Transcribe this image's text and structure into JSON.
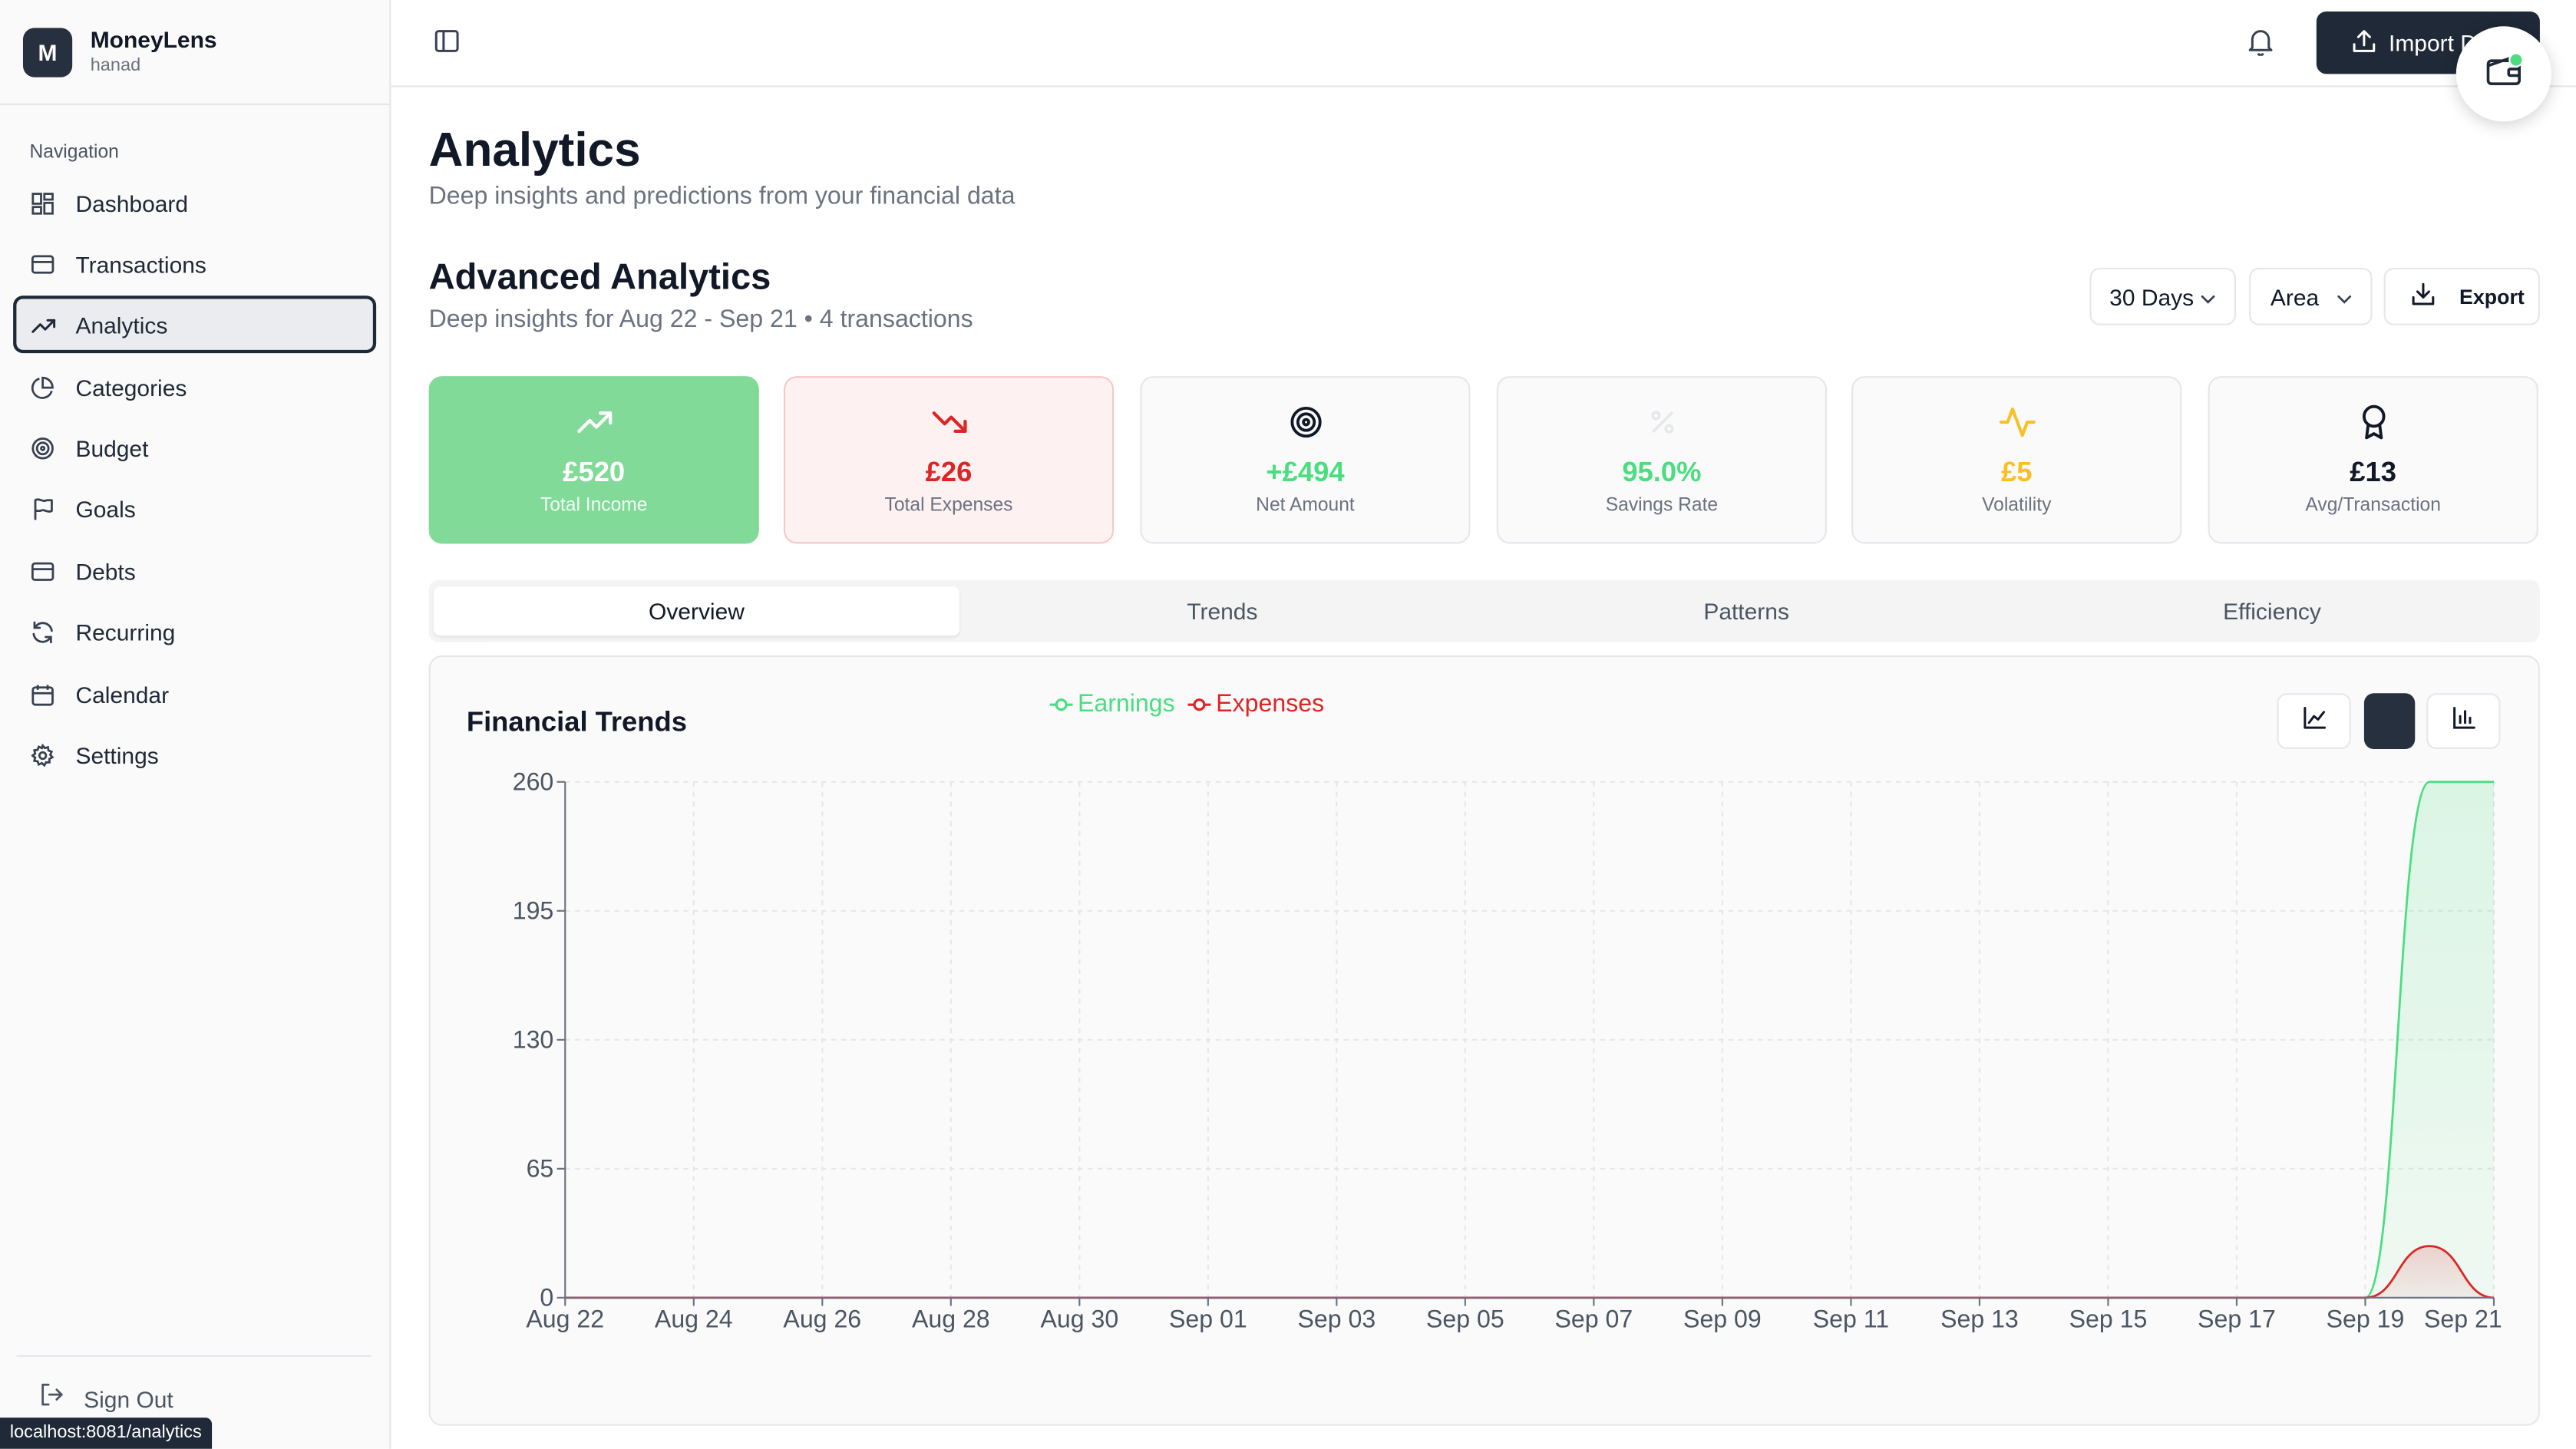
{
  "brand": {
    "initial": "M",
    "name": "MoneyLens",
    "user": "hanad"
  },
  "nav": {
    "heading": "Navigation",
    "items": [
      {
        "label": "Dashboard",
        "icon": "dashboard-icon"
      },
      {
        "label": "Transactions",
        "icon": "card-icon"
      },
      {
        "label": "Analytics",
        "icon": "trending-up-icon",
        "active": true
      },
      {
        "label": "Categories",
        "icon": "pie-chart-icon"
      },
      {
        "label": "Budget",
        "icon": "target-icon"
      },
      {
        "label": "Goals",
        "icon": "flag-icon"
      },
      {
        "label": "Debts",
        "icon": "card-icon"
      },
      {
        "label": "Recurring",
        "icon": "refresh-icon"
      },
      {
        "label": "Calendar",
        "icon": "calendar-icon"
      },
      {
        "label": "Settings",
        "icon": "gear-icon"
      }
    ],
    "sign_out": "Sign Out"
  },
  "status_url": "localhost:8081/analytics",
  "topbar": {
    "import_label": "Import D"
  },
  "page": {
    "title": "Analytics",
    "subtitle": "Deep insights and predictions from your financial data"
  },
  "analytics": {
    "title": "Advanced Analytics",
    "subtitle": "Deep insights for Aug 22 - Sep 21 • 4 transactions",
    "range_select": "30 Days",
    "type_select": "Area",
    "export_label": "Export"
  },
  "cards": [
    {
      "value": "£520",
      "caption": "Total Income",
      "icon": "trending-up-icon",
      "color": "#ffffff"
    },
    {
      "value": "£26",
      "caption": "Total Expenses",
      "icon": "trending-down-icon",
      "color": "#dc2626"
    },
    {
      "value": "+£494",
      "caption": "Net Amount",
      "icon": "target-icon",
      "color": "#4ade80"
    },
    {
      "value": "95.0%",
      "caption": "Savings Rate",
      "icon": "percent-icon",
      "color": "#4ade80"
    },
    {
      "value": "£5",
      "caption": "Volatility",
      "icon": "activity-icon",
      "color": "#fbbf24"
    },
    {
      "value": "£13",
      "caption": "Avg/Transaction",
      "icon": "award-icon",
      "color": "#111827"
    }
  ],
  "tabs": [
    {
      "label": "Overview",
      "active": true
    },
    {
      "label": "Trends"
    },
    {
      "label": "Patterns"
    },
    {
      "label": "Efficiency"
    }
  ],
  "chart_panel": {
    "title": "Financial Trends"
  },
  "colors": {
    "earnings": "#4ade80",
    "expenses": "#dc2626",
    "accent": "#1f2937"
  },
  "chart_data": {
    "type": "area",
    "title": "Financial Trends",
    "xlabel": "",
    "ylabel": "",
    "ylim": [
      0,
      260
    ],
    "yticks": [
      0,
      65,
      130,
      195,
      260
    ],
    "xtick_labels": [
      "Aug 22",
      "Aug 24",
      "Aug 26",
      "Aug 28",
      "Aug 30",
      "Sep 01",
      "Sep 03",
      "Sep 05",
      "Sep 07",
      "Sep 09",
      "Sep 11",
      "Sep 13",
      "Sep 15",
      "Sep 17",
      "Sep 19",
      "Sep 21"
    ],
    "categories": [
      "Aug 22",
      "Aug 23",
      "Aug 24",
      "Aug 25",
      "Aug 26",
      "Aug 27",
      "Aug 28",
      "Aug 29",
      "Aug 30",
      "Aug 31",
      "Sep 01",
      "Sep 02",
      "Sep 03",
      "Sep 04",
      "Sep 05",
      "Sep 06",
      "Sep 07",
      "Sep 08",
      "Sep 09",
      "Sep 10",
      "Sep 11",
      "Sep 12",
      "Sep 13",
      "Sep 14",
      "Sep 15",
      "Sep 16",
      "Sep 17",
      "Sep 18",
      "Sep 19",
      "Sep 20",
      "Sep 21"
    ],
    "series": [
      {
        "name": "Earnings",
        "color": "#4ade80",
        "values": [
          0,
          0,
          0,
          0,
          0,
          0,
          0,
          0,
          0,
          0,
          0,
          0,
          0,
          0,
          0,
          0,
          0,
          0,
          0,
          0,
          0,
          0,
          0,
          0,
          0,
          0,
          0,
          0,
          0,
          260,
          260
        ]
      },
      {
        "name": "Expenses",
        "color": "#dc2626",
        "values": [
          0,
          0,
          0,
          0,
          0,
          0,
          0,
          0,
          0,
          0,
          0,
          0,
          0,
          0,
          0,
          0,
          0,
          0,
          0,
          0,
          0,
          0,
          0,
          0,
          0,
          0,
          0,
          0,
          0,
          26,
          0
        ]
      }
    ],
    "grid": true,
    "legend": "bottom-center"
  }
}
